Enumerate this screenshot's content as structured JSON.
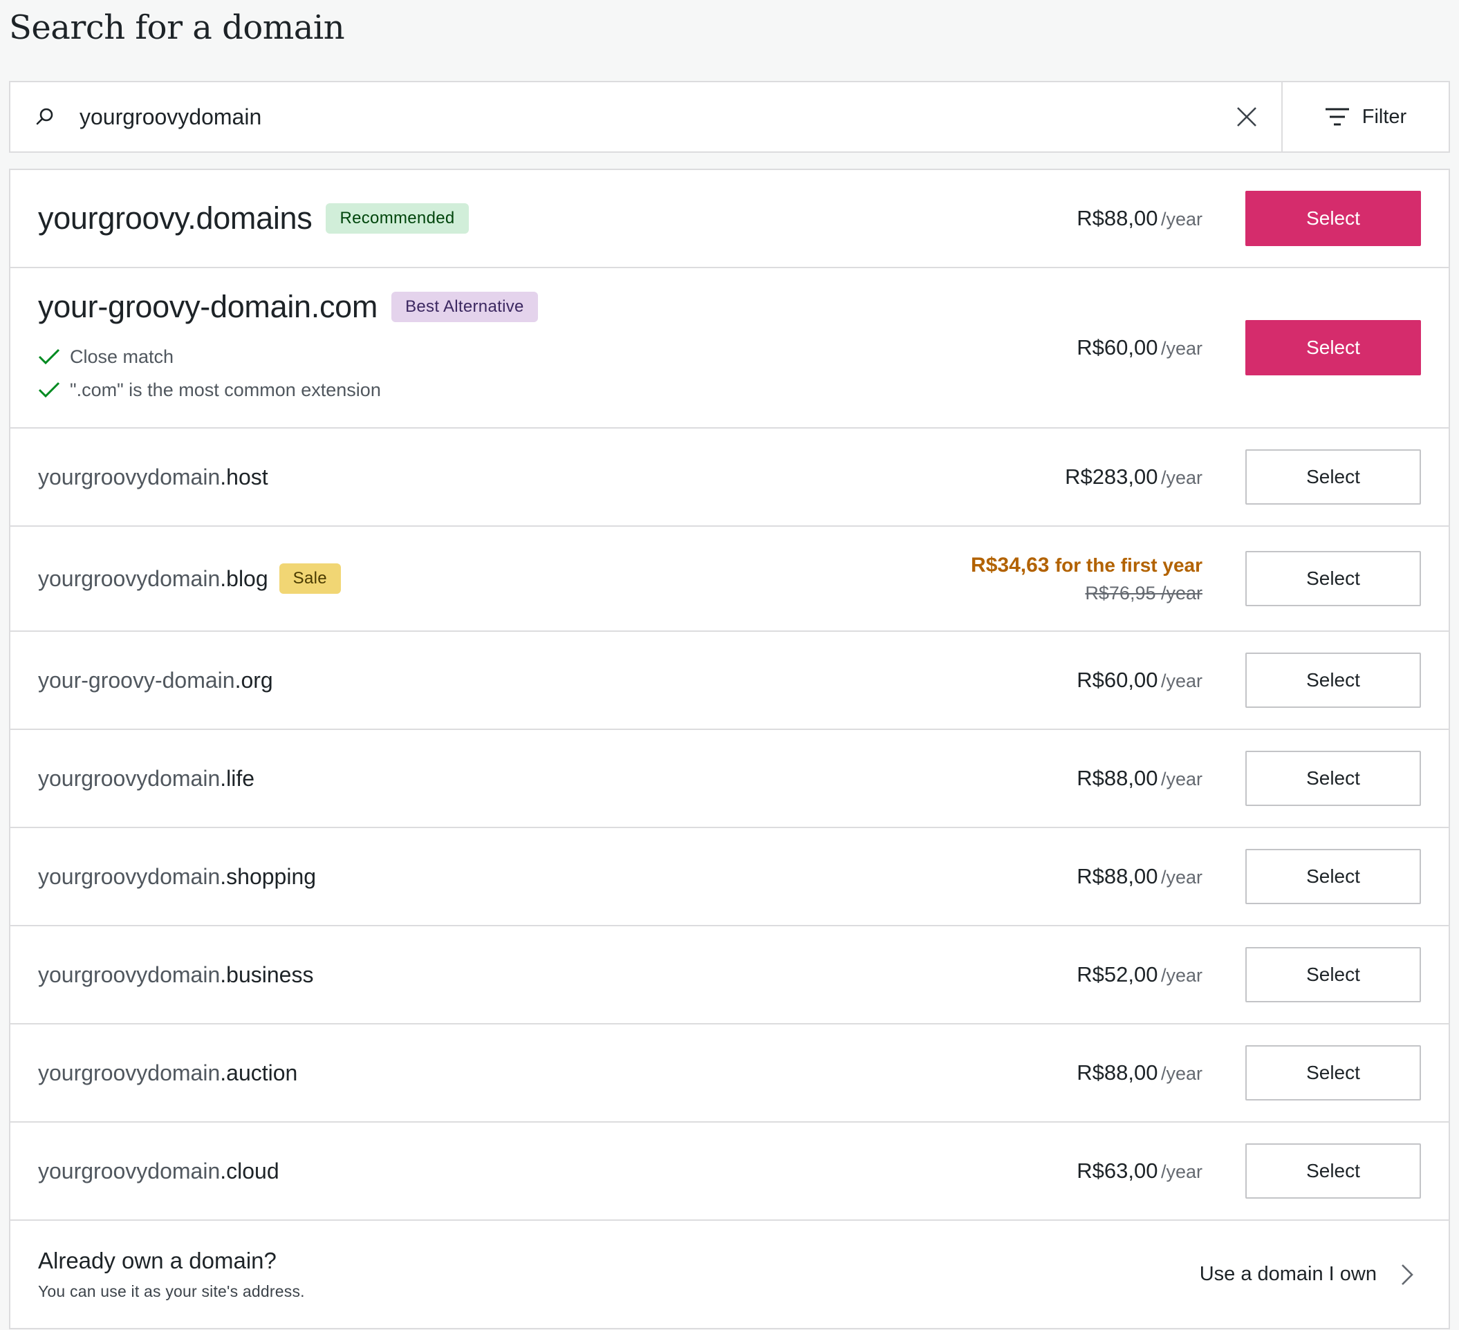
{
  "page": {
    "title": "Search for a domain"
  },
  "search": {
    "value": "yourgroovydomain",
    "filter_label": "Filter"
  },
  "colors": {
    "primary": "#d52c6c",
    "sale": "#b26200",
    "recommended_bg": "#d1eed9",
    "best_bg": "#e4d3ec",
    "sale_bg": "#f1d674",
    "check": "#008a20"
  },
  "featured": [
    {
      "domain": "yourgroovy.domains",
      "badge": "Recommended",
      "price": "R$88,00",
      "period": "/year",
      "button": "Select"
    },
    {
      "domain": "your-groovy-domain.com",
      "badge": "Best Alternative",
      "reasons": [
        "Close match",
        "\".com\" is the most common extension"
      ],
      "price": "R$60,00",
      "period": "/year",
      "button": "Select"
    }
  ],
  "results": [
    {
      "name": "yourgroovydomain",
      "tld": ".host",
      "price": "R$283,00",
      "period": "/year",
      "button": "Select"
    },
    {
      "name": "yourgroovydomain",
      "tld": ".blog",
      "badge": "Sale",
      "sale_price": "R$34,63",
      "sale_suffix": "for the first year",
      "original_price": "R$76,95 /year",
      "button": "Select"
    },
    {
      "name": "your-groovy-domain",
      "tld": ".org",
      "price": "R$60,00",
      "period": "/year",
      "button": "Select"
    },
    {
      "name": "yourgroovydomain",
      "tld": ".life",
      "price": "R$88,00",
      "period": "/year",
      "button": "Select"
    },
    {
      "name": "yourgroovydomain",
      "tld": ".shopping",
      "price": "R$88,00",
      "period": "/year",
      "button": "Select"
    },
    {
      "name": "yourgroovydomain",
      "tld": ".business",
      "price": "R$52,00",
      "period": "/year",
      "button": "Select"
    },
    {
      "name": "yourgroovydomain",
      "tld": ".auction",
      "price": "R$88,00",
      "period": "/year",
      "button": "Select"
    },
    {
      "name": "yourgroovydomain",
      "tld": ".cloud",
      "price": "R$63,00",
      "period": "/year",
      "button": "Select"
    }
  ],
  "own_domain": {
    "title": "Already own a domain?",
    "subtitle": "You can use it as your site's address.",
    "link": "Use a domain I own"
  }
}
